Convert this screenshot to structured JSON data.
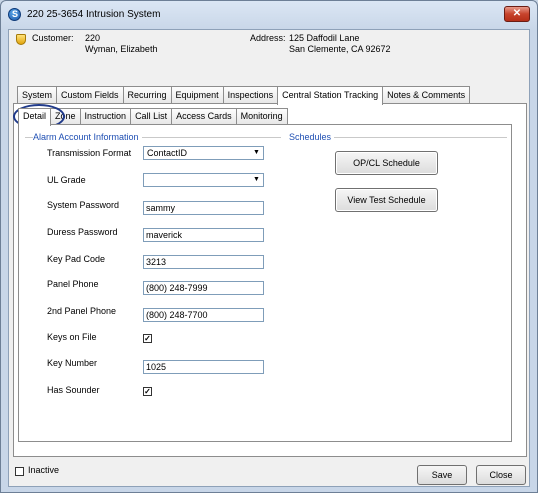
{
  "window": {
    "title": "220 25-3654 Intrusion System",
    "app_icon_letter": "S",
    "close_glyph": "✕"
  },
  "header": {
    "customer_label": "Customer:",
    "customer_number": "220",
    "customer_name": "Wyman, Elizabeth",
    "address_label": "Address:",
    "address_line1": "125 Daffodil Lane",
    "address_line2": "San Clemente, CA  92672"
  },
  "tabs": [
    {
      "label": "System"
    },
    {
      "label": "Custom Fields"
    },
    {
      "label": "Recurring"
    },
    {
      "label": "Equipment"
    },
    {
      "label": "Inspections"
    },
    {
      "label": "Central Station Tracking"
    },
    {
      "label": "Notes & Comments"
    }
  ],
  "subtabs": [
    {
      "label": "Detail"
    },
    {
      "label": "Zone"
    },
    {
      "label": "Instruction"
    },
    {
      "label": "Call List"
    },
    {
      "label": "Access Cards"
    },
    {
      "label": "Monitoring"
    }
  ],
  "alarm": {
    "group_title": "Alarm Account Information",
    "transmission_format_label": "Transmission Format",
    "transmission_format_value": "ContactID",
    "ul_grade_label": "UL Grade",
    "ul_grade_value": "",
    "system_password_label": "System Password",
    "system_password_value": "sammy",
    "duress_password_label": "Duress Password",
    "duress_password_value": "maverick",
    "keypad_code_label": "Key Pad Code",
    "keypad_code_value": "3213",
    "panel_phone_label": "Panel Phone",
    "panel_phone_value": "(800) 248-7999",
    "panel_phone2_label": "2nd Panel Phone",
    "panel_phone2_value": "(800) 248-7700",
    "keys_on_file_label": "Keys on File",
    "keys_on_file_checked": true,
    "key_number_label": "Key Number",
    "key_number_value": "1025",
    "has_sounder_label": "Has Sounder",
    "has_sounder_checked": true,
    "check_glyph": "✓",
    "dropdown_glyph": "▼"
  },
  "schedules": {
    "group_title": "Schedules",
    "opcl_button": "OP/CL Schedule",
    "view_test_button": "View Test Schedule"
  },
  "footer": {
    "inactive_label": "Inactive",
    "save_button": "Save",
    "close_button": "Close"
  }
}
